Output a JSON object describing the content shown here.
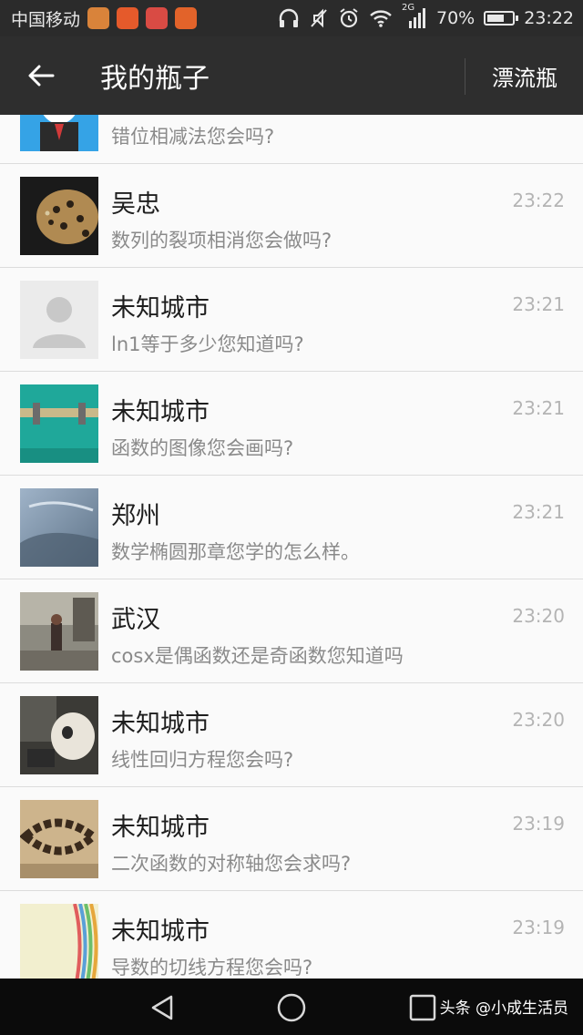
{
  "status_bar": {
    "carrier": "中国移动",
    "network": "2G",
    "battery": "70%",
    "battery_level": 0.7,
    "time": "23:22",
    "app_icon_colors": [
      "#d9833a",
      "#e55a2b",
      "#d94b44",
      "#e2632a"
    ]
  },
  "header": {
    "back_icon": "arrow-left-icon",
    "title": "我的瓶子",
    "action": "漂流瓶"
  },
  "bottles": [
    {
      "name": "",
      "message": "错位相减法您会吗?",
      "time": "",
      "avatar": "rabbit-avatar"
    },
    {
      "name": "吴忠",
      "message": "数列的裂项相消您会做吗?",
      "time": "23:22",
      "avatar": "leopard-avatar"
    },
    {
      "name": "未知城市",
      "message": "ln1等于多少您知道吗?",
      "time": "23:21",
      "avatar": "default-person-avatar"
    },
    {
      "name": "未知城市",
      "message": "函数的图像您会画吗?",
      "time": "23:21",
      "avatar": "teal-door-avatar"
    },
    {
      "name": "郑州",
      "message": "数学椭圆那章您学的怎么样。",
      "time": "23:21",
      "avatar": "sky-avatar"
    },
    {
      "name": "武汉",
      "message": "cosx是偶函数还是奇函数您知道吗",
      "time": "23:20",
      "avatar": "street-avatar"
    },
    {
      "name": "未知城市",
      "message": "线性回归方程您会吗?",
      "time": "23:20",
      "avatar": "dog-avatar"
    },
    {
      "name": "未知城市",
      "message": "二次函数的对称轴您会求吗?",
      "time": "23:19",
      "avatar": "bracelet-avatar"
    },
    {
      "name": "未知城市",
      "message": "导数的切线方程您会吗?",
      "time": "23:19",
      "avatar": "stripes-avatar"
    }
  ],
  "watermark": "头条 @小成生活员"
}
